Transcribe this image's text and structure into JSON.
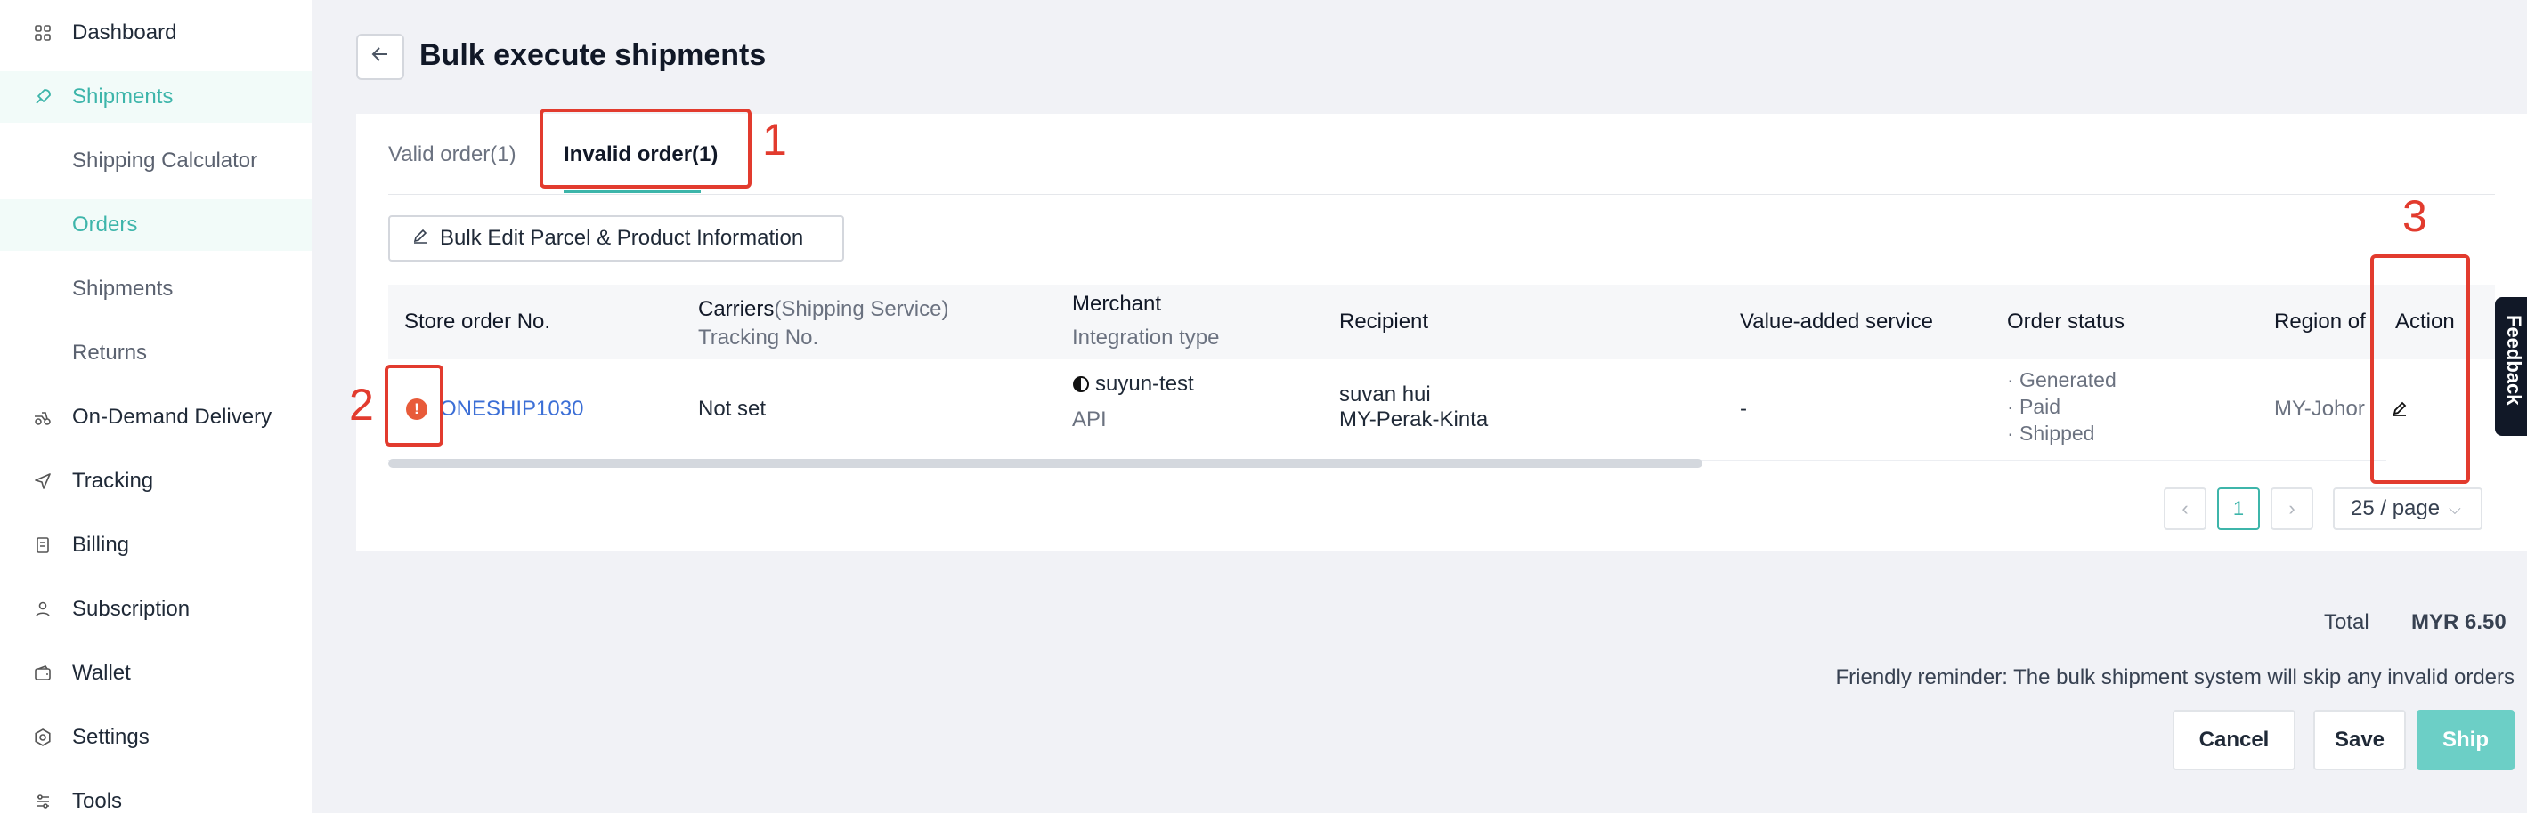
{
  "sidebar": {
    "items": [
      {
        "label": "Dashboard",
        "icon": "grid-icon"
      },
      {
        "label": "Shipments",
        "icon": "rocket-icon"
      },
      {
        "label": "Shipping Calculator"
      },
      {
        "label": "Orders"
      },
      {
        "label": "Shipments"
      },
      {
        "label": "Returns"
      },
      {
        "label": "On-Demand Delivery",
        "icon": "delivery-icon"
      },
      {
        "label": "Tracking",
        "icon": "send-icon"
      },
      {
        "label": "Billing",
        "icon": "receipt-icon"
      },
      {
        "label": "Subscription",
        "icon": "user-icon"
      },
      {
        "label": "Wallet",
        "icon": "wallet-icon"
      },
      {
        "label": "Settings",
        "icon": "settings-icon"
      },
      {
        "label": "Tools",
        "icon": "tools-icon"
      }
    ]
  },
  "header": {
    "title": "Bulk execute shipments"
  },
  "tabs": {
    "valid": "Valid order(1)",
    "invalid": "Invalid order(1)"
  },
  "toolbar": {
    "bulk_edit_label": "Bulk Edit Parcel & Product Information"
  },
  "table": {
    "headers": {
      "store_order": "Store order No.",
      "carriers": "Carriers",
      "shipping_service": "(Shipping Service)",
      "tracking": "Tracking No.",
      "merchant": "Merchant",
      "integration": "Integration type",
      "recipient": "Recipient",
      "vas": "Value-added service",
      "status": "Order status",
      "region": "Region of",
      "action": "Action"
    },
    "row": {
      "order_no": "ONESHIP1030",
      "carrier": "Not set",
      "merchant": "suyun-test",
      "integration": "API",
      "recipient_name": "suvan hui",
      "recipient_region": "MY-Perak-Kinta",
      "vas": "-",
      "status": [
        "· Generated",
        "· Paid",
        "· Shipped"
      ],
      "region": "MY-Johor"
    }
  },
  "pagination": {
    "current": "1",
    "page_size": "25 / page"
  },
  "annotations": [
    "1",
    "2",
    "3"
  ],
  "summary": {
    "total_label": "Total",
    "total_value": "MYR 6.50",
    "reminder": "Friendly reminder: The bulk shipment system will skip any invalid orders"
  },
  "actions": {
    "cancel": "Cancel",
    "save": "Save",
    "ship": "Ship"
  },
  "feedback_label": "Feedback",
  "colors": {
    "accent": "#3db5aa",
    "link": "#3c6fd6",
    "error": "#e85b3a",
    "annotation": "#e23b2e"
  }
}
